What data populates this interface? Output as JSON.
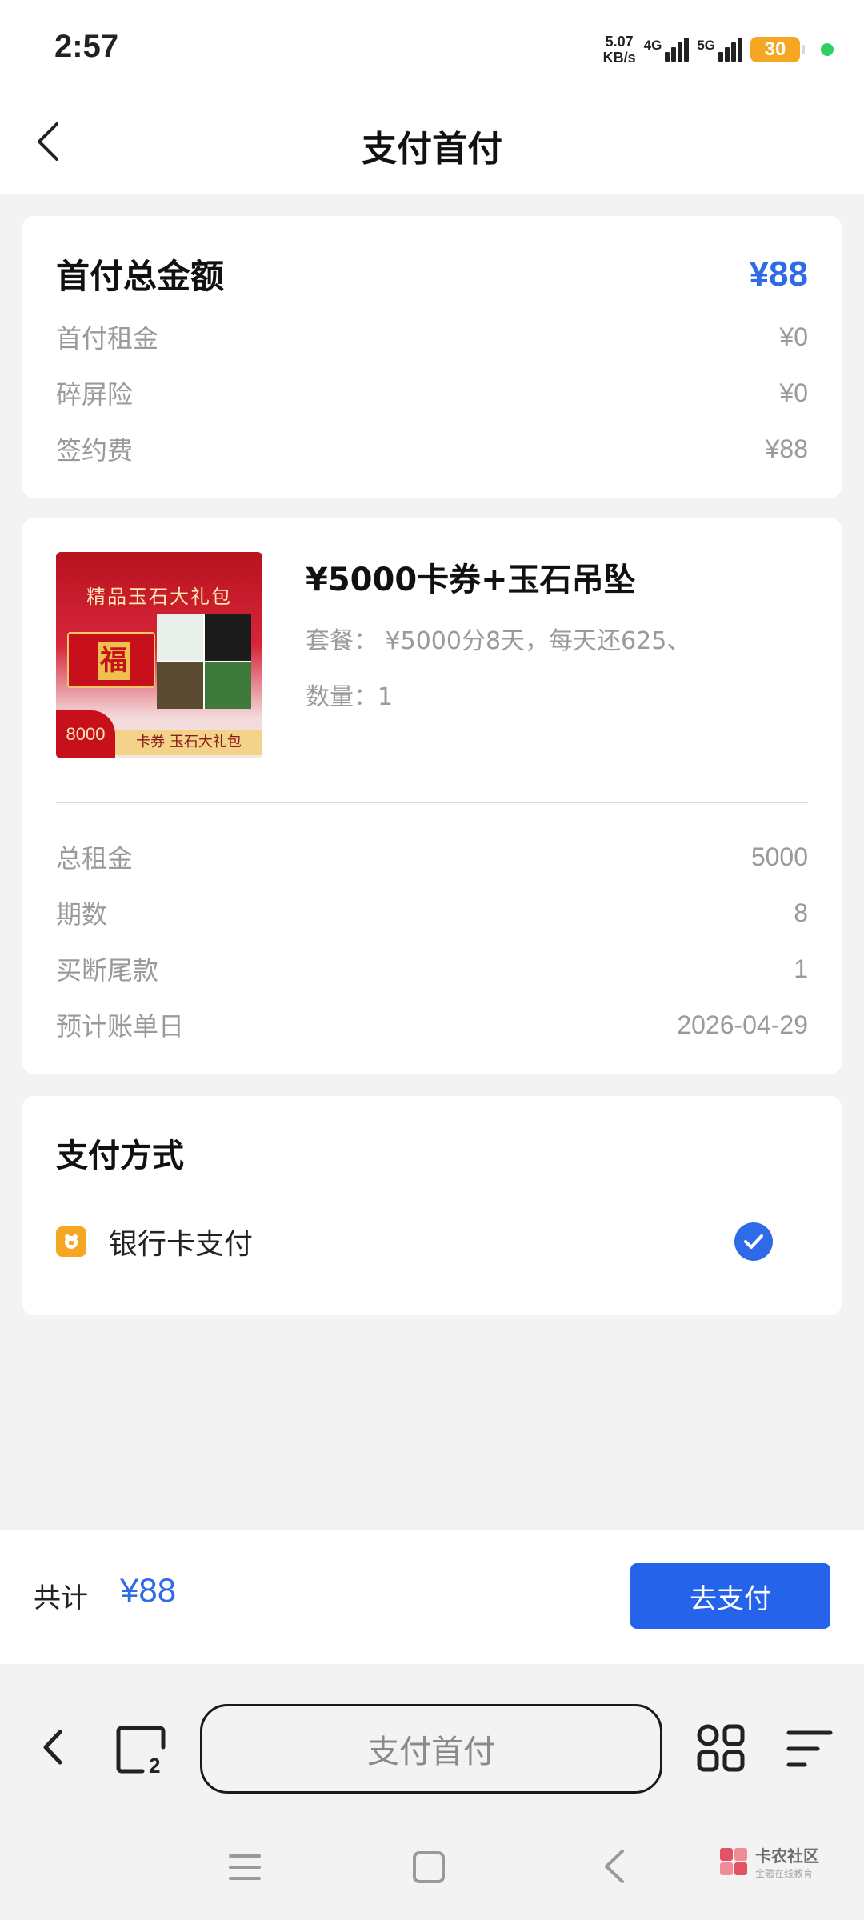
{
  "status_bar": {
    "time": "2:57",
    "speed_value": "5.07",
    "speed_unit": "KB/s",
    "network1": "4G",
    "network2": "5G",
    "battery": "30"
  },
  "header": {
    "title": "支付首付"
  },
  "summary": {
    "total_label": "首付总金额",
    "total_value": "¥88",
    "rows": [
      {
        "label": "首付租金",
        "value": "¥0"
      },
      {
        "label": "碎屏险",
        "value": "¥0"
      },
      {
        "label": "签约费",
        "value": "¥88"
      }
    ]
  },
  "product": {
    "name": "¥5000卡券+玉石吊坠",
    "package": "套餐：  ¥5000分8天，每天还625、",
    "quantity": "数量：1",
    "image": {
      "title": "精品玉石大礼包",
      "fu": "福",
      "price": "8000",
      "banner": "卡券 玉石大礼包"
    },
    "rows": [
      {
        "label": "总租金",
        "value": "5000"
      },
      {
        "label": "期数",
        "value": "8"
      },
      {
        "label": "买断尾款",
        "value": "1"
      },
      {
        "label": "预计账单日",
        "value": "2026-04-29"
      }
    ]
  },
  "payment": {
    "title": "支付方式",
    "method_label": "银行卡支付",
    "selected": true
  },
  "paybar": {
    "total_label": "共计",
    "total_value": "¥88",
    "button_label": "去支付"
  },
  "browser": {
    "url_text": "支付首付",
    "tab_count": "2"
  },
  "watermark": {
    "line1": "卡农社区",
    "line2": "金融在线教育"
  },
  "colors": {
    "accent": "#2f6be6",
    "button": "#2563eb",
    "battery": "#f5a623"
  }
}
